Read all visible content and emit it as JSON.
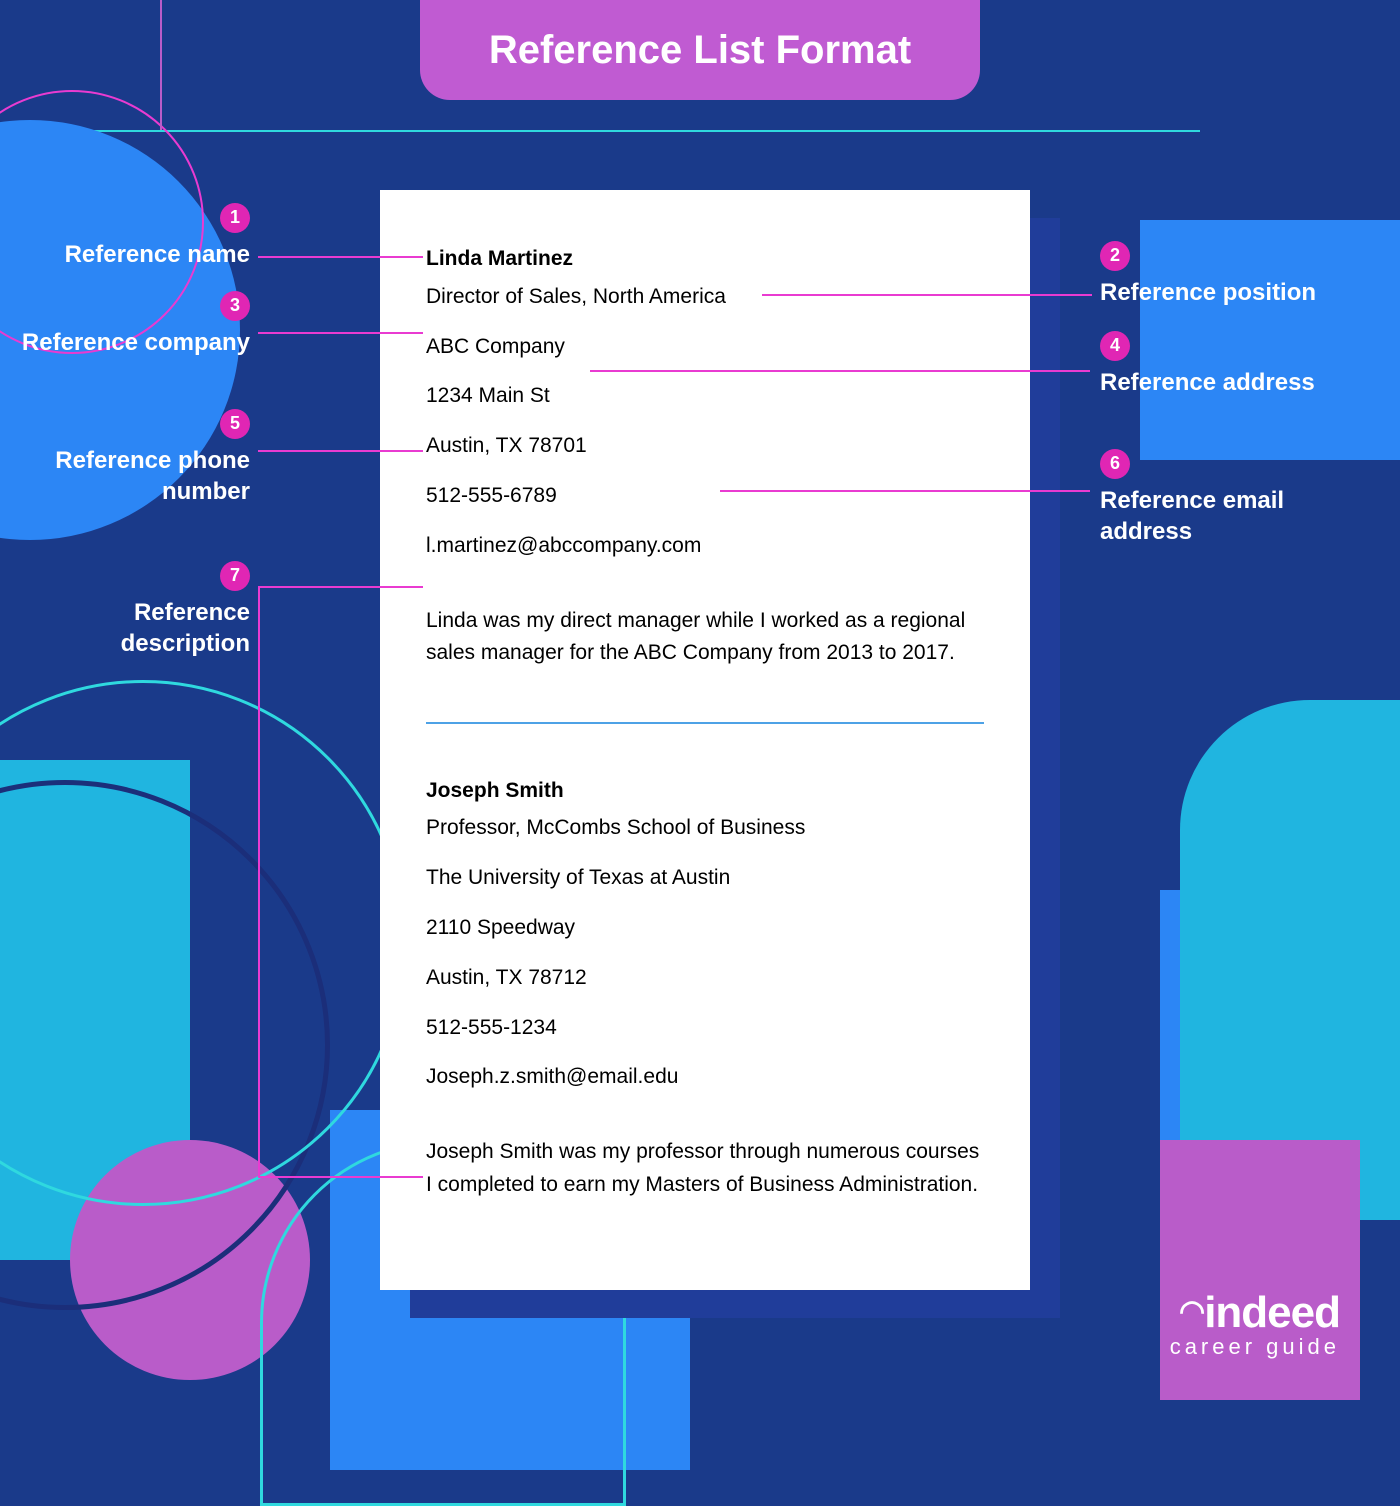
{
  "title": "Reference List Format",
  "annotations": [
    {
      "n": "1",
      "label": "Reference name"
    },
    {
      "n": "2",
      "label": "Reference position"
    },
    {
      "n": "3",
      "label": "Reference company"
    },
    {
      "n": "4",
      "label": "Reference address"
    },
    {
      "n": "5",
      "label": "Reference phone number"
    },
    {
      "n": "6",
      "label": "Reference email address"
    },
    {
      "n": "7",
      "label": "Reference description"
    }
  ],
  "references": [
    {
      "name": "Linda Martinez",
      "position": "Director of Sales, North America",
      "company": "ABC Company",
      "address1": "1234 Main St",
      "address2": "Austin, TX 78701",
      "phone": "512-555-6789",
      "email": "l.martinez@abccompany.com",
      "description": "Linda was my direct manager while I worked as a regional sales manager for the ABC Company from 2013 to 2017."
    },
    {
      "name": "Joseph Smith",
      "position": "Professor, McCombs School of Business",
      "company": "The University of Texas at Austin",
      "address1": "2110 Speedway",
      "address2": "Austin, TX 78712",
      "phone": "512-555-1234",
      "email": "Joseph.z.smith@email.edu",
      "description": "Joseph Smith was my professor through numerous courses I completed to earn my Masters of Business Administration."
    }
  ],
  "brand": {
    "name": "indeed",
    "tagline": "career guide"
  }
}
